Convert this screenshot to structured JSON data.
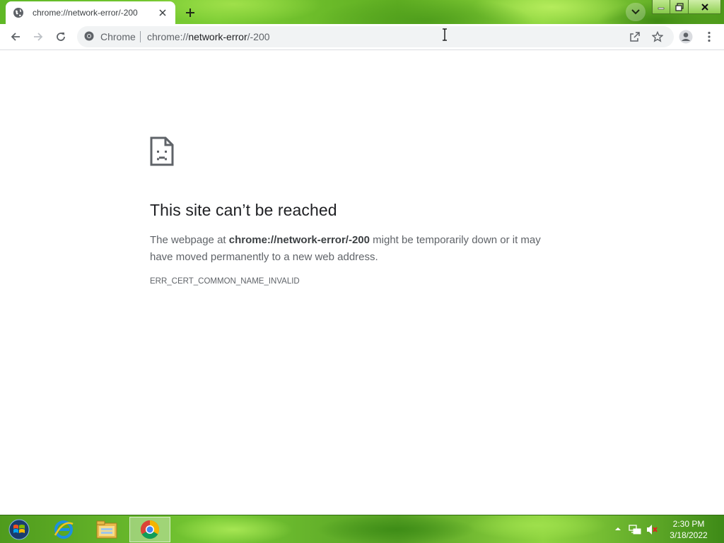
{
  "browser": {
    "tab": {
      "title": "chrome://network-error/-200"
    },
    "omnibox": {
      "chip_label": "Chrome",
      "url_prefix": "chrome://",
      "url_host": "network-error",
      "url_path": "/-200"
    }
  },
  "page": {
    "heading": "This site can’t be reached",
    "message_before": "The webpage at ",
    "message_url": "chrome://network-error/-200",
    "message_after": " might be temporarily down or it may have moved permanently to a new web address.",
    "error_code": "ERR_CERT_COMMON_NAME_INVALID"
  },
  "taskbar": {
    "apps": [
      {
        "name": "internet-explorer",
        "icon": "ie-icon"
      },
      {
        "name": "file-explorer",
        "icon": "folder-icon"
      },
      {
        "name": "chrome",
        "icon": "chrome-icon",
        "active": true
      }
    ],
    "clock": {
      "time": "2:30 PM",
      "date": "3/18/2022"
    }
  },
  "colors": {
    "accent_green": "#7ccd34",
    "heading": "#202124",
    "body_text": "#5f6368",
    "omnibox_bg": "#f1f3f4"
  }
}
